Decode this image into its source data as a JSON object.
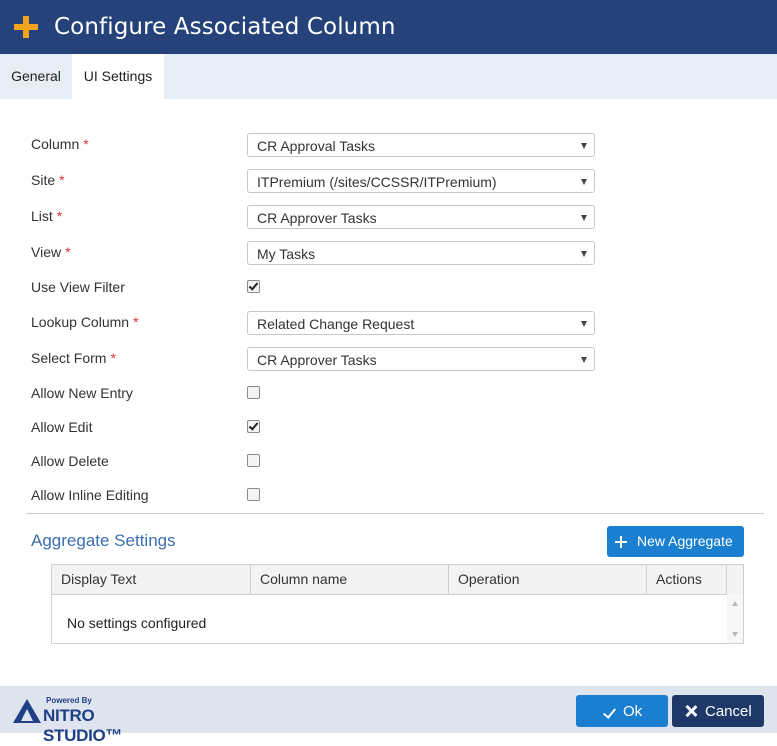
{
  "window": {
    "title": "Configure Associated Column"
  },
  "tabs": [
    {
      "label": "General"
    },
    {
      "label": "UI Settings"
    }
  ],
  "form": {
    "column": {
      "label": "Column",
      "required": "*",
      "value": "CR Approval Tasks"
    },
    "site": {
      "label": "Site",
      "required": "*",
      "value": "ITPremium (/sites/CCSSR/ITPremium)"
    },
    "list": {
      "label": "List",
      "required": "*",
      "value": "CR Approver Tasks"
    },
    "view": {
      "label": "View",
      "required": "*",
      "value": "My Tasks"
    },
    "use_view_filter": {
      "label": "Use View Filter",
      "checked": true
    },
    "lookup_column": {
      "label": "Lookup Column",
      "required": "*",
      "value": "Related Change Request"
    },
    "select_form": {
      "label": "Select Form",
      "required": "*",
      "value": "CR Approver Tasks"
    },
    "allow_new_entry": {
      "label": "Allow New Entry",
      "checked": false
    },
    "allow_edit": {
      "label": "Allow Edit",
      "checked": true
    },
    "allow_delete": {
      "label": "Allow Delete",
      "checked": false
    },
    "allow_inline_editing": {
      "label": "Allow Inline Editing",
      "checked": false
    }
  },
  "aggregate": {
    "title": "Aggregate Settings",
    "new_button": "New Aggregate",
    "columns": [
      "Display Text",
      "Column name",
      "Operation",
      "Actions"
    ],
    "empty_text": "No settings configured"
  },
  "footer": {
    "logo_powered": "Powered By",
    "logo_brand": "NITRO STUDIO™",
    "ok": "Ok",
    "cancel": "Cancel"
  },
  "colors": {
    "title_bar": "#25437a",
    "accent_plus": "#f3a41f",
    "primary_button": "#1a7fd0",
    "cancel_button": "#1e3868",
    "required": "#e0303b",
    "section_title": "#3a6fb0"
  }
}
